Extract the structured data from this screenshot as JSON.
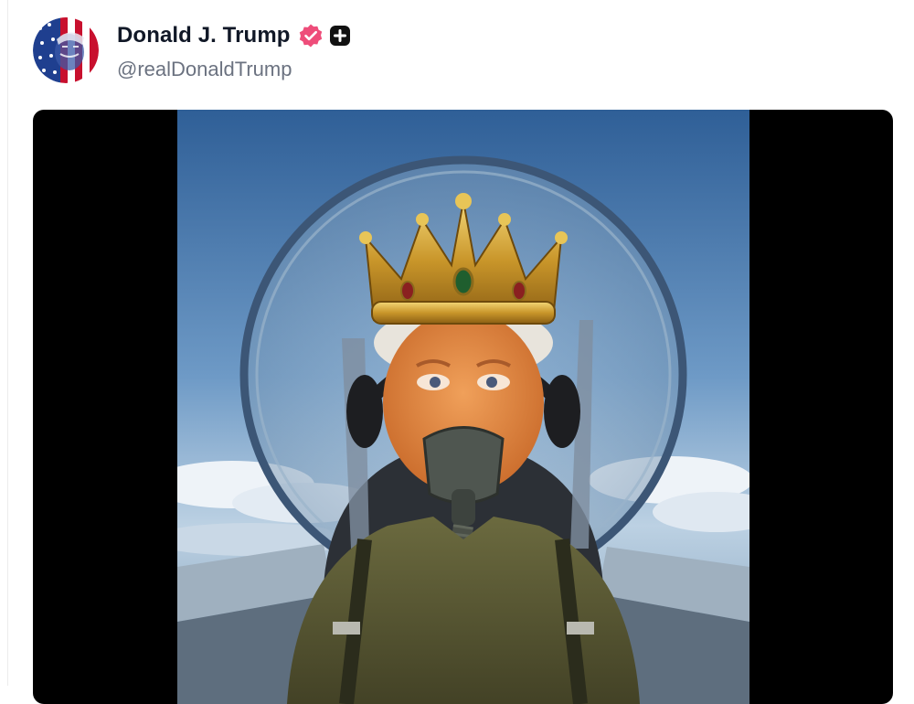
{
  "post": {
    "author": {
      "display_name": "Donald J. Trump",
      "handle": "@realDonaldTrump",
      "verified": true,
      "verified_icon": "verified-badge-icon",
      "badge_icon": "plus-icon"
    },
    "media": {
      "type": "image",
      "subject": "crowned pilot in jet cockpit"
    }
  },
  "colors": {
    "verified": "#ee4d7a",
    "name": "#111827",
    "handle": "#6b7280",
    "media_background": "#000000"
  }
}
